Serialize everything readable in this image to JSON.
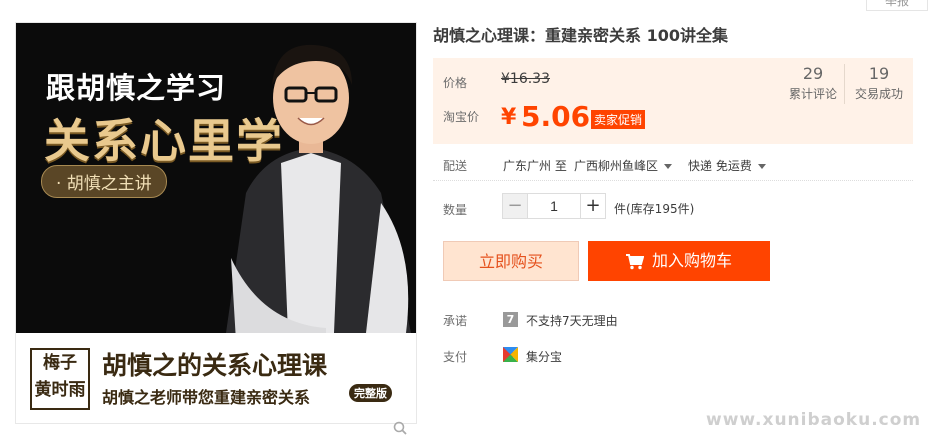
{
  "report": "举报",
  "product": {
    "title": "胡慎之心理课：重建亲密关系 100讲全集"
  },
  "image": {
    "line1": "跟胡慎之学习",
    "line2": "关系心里学",
    "speaker": "· 胡慎之主讲",
    "stamp_line1": "梅子",
    "stamp_line2": "黄时雨",
    "banner_title": "胡慎之的关系心理课",
    "banner_sub": "胡慎之老师带您重建亲密关系",
    "banner_tag": "完整版"
  },
  "price": {
    "label": "价格",
    "original": "¥16.33",
    "taobao_label": "淘宝价",
    "currency": "¥",
    "current": "5.06",
    "promo": "卖家促销"
  },
  "stats": {
    "reviews_num": "29",
    "reviews_label": "累计评论",
    "deals_num": "19",
    "deals_label": "交易成功"
  },
  "shipping": {
    "label": "配送",
    "from": "广东广州 至",
    "to": "广西柳州鱼峰区",
    "method": "快递 免运费"
  },
  "quantity": {
    "label": "数量",
    "minus": "−",
    "value": "1",
    "plus": "+",
    "stock": "件(库存195件)"
  },
  "actions": {
    "buy_now": "立即购买",
    "add_to_cart": "加入购物车"
  },
  "promise": {
    "label": "承诺",
    "icon_text": "7",
    "text": "不支持7天无理由"
  },
  "payment": {
    "label": "支付",
    "text": "集分宝"
  },
  "watermark": "www.xunibaoku.com",
  "colors": {
    "accent": "#ff4400",
    "price_bg": "#fff2e8",
    "buy_now_bg": "#ffe4d0"
  }
}
